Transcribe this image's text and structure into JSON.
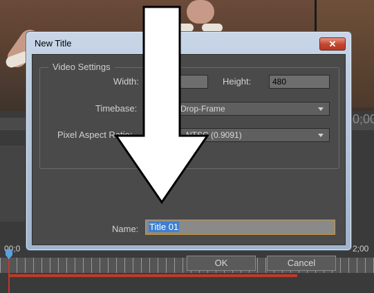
{
  "dialog": {
    "title": "New Title",
    "close_icon": "close-icon",
    "video_settings": {
      "legend": "Video Settings",
      "width_label": "Width:",
      "width_value": "",
      "height_label": "Height:",
      "height_value": "480",
      "timebase_label": "Timebase:",
      "timebase_value": "ps Drop-Frame",
      "par_label": "Pixel Aspect Ratio:",
      "par_value": "NTSC (0.9091)"
    },
    "name_label": "Name:",
    "name_value": "Title 01",
    "ok_label": "OK",
    "cancel_label": "Cancel"
  },
  "background": {
    "timecode_right_top": "0;00",
    "timecode_left_bottom": "00;0",
    "timecode_right_bottom": "2;00"
  },
  "colors": {
    "dialog_body": "#4a4a4a",
    "titlebar": "#c8d6e8",
    "close_button": "#c2452f",
    "name_focus_border": "#c99a35",
    "selection": "#3d7fd0",
    "timeline_red": "#c0392b"
  }
}
